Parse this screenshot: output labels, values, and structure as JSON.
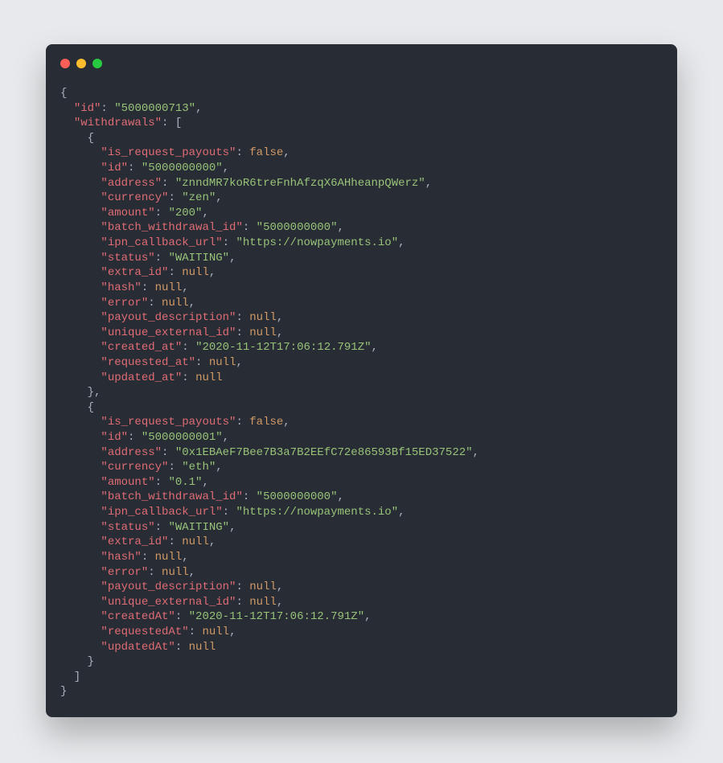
{
  "colors": {
    "bg_page": "#e7e9ec",
    "bg_window": "#282c34",
    "text_plain": "#abb2bf",
    "text_key": "#e06c75",
    "text_string": "#98c379",
    "text_keyword": "#d19a66",
    "tl_red": "#ff5f56",
    "tl_yellow": "#ffbd2e",
    "tl_green": "#27c93f"
  },
  "json_content": {
    "id": "5000000713",
    "withdrawals": [
      {
        "is_request_payouts": false,
        "id": "5000000000",
        "address": "znndMR7koR6treFnhAfzqX6AHheanpQWerz",
        "currency": "zen",
        "amount": "200",
        "batch_withdrawal_id": "5000000000",
        "ipn_callback_url": "https://nowpayments.io",
        "status": "WAITING",
        "extra_id": null,
        "hash": null,
        "error": null,
        "payout_description": null,
        "unique_external_id": null,
        "created_at": "2020-11-12T17:06:12.791Z",
        "requested_at": null,
        "updated_at": null
      },
      {
        "is_request_payouts": false,
        "id": "5000000001",
        "address": "0x1EBAeF7Bee7B3a7B2EEfC72e86593Bf15ED37522",
        "currency": "eth",
        "amount": "0.1",
        "batch_withdrawal_id": "5000000000",
        "ipn_callback_url": "https://nowpayments.io",
        "status": "WAITING",
        "extra_id": null,
        "hash": null,
        "error": null,
        "payout_description": null,
        "unique_external_id": null,
        "createdAt": "2020-11-12T17:06:12.791Z",
        "requestedAt": null,
        "updatedAt": null
      }
    ]
  },
  "key_tokens": {
    "id": "\"id\"",
    "withdrawals": "\"withdrawals\"",
    "is_request_payouts": "\"is_request_payouts\"",
    "address": "\"address\"",
    "currency": "\"currency\"",
    "amount": "\"amount\"",
    "batch_withdrawal_id": "\"batch_withdrawal_id\"",
    "ipn_callback_url": "\"ipn_callback_url\"",
    "status": "\"status\"",
    "extra_id": "\"extra_id\"",
    "hash": "\"hash\"",
    "error": "\"error\"",
    "payout_description": "\"payout_description\"",
    "unique_external_id": "\"unique_external_id\"",
    "created_at": "\"created_at\"",
    "requested_at": "\"requested_at\"",
    "updated_at": "\"updated_at\"",
    "createdAt": "\"createdAt\"",
    "requestedAt": "\"requestedAt\"",
    "updatedAt": "\"updatedAt\""
  },
  "val_tokens": {
    "root_id": "\"5000000713\"",
    "w0_id": "\"5000000000\"",
    "w0_address": "\"znndMR7koR6treFnhAfzqX6AHheanpQWerz\"",
    "w0_currency": "\"zen\"",
    "w0_amount": "\"200\"",
    "w0_batch": "\"5000000000\"",
    "w0_ipn": "\"https://nowpayments.io\"",
    "w0_status": "\"WAITING\"",
    "w0_created": "\"2020-11-12T17:06:12.791Z\"",
    "w1_id": "\"5000000001\"",
    "w1_address": "\"0x1EBAeF7Bee7B3a7B2EEfC72e86593Bf15ED37522\"",
    "w1_currency": "\"eth\"",
    "w1_amount": "\"0.1\"",
    "w1_batch": "\"5000000000\"",
    "w1_ipn": "\"https://nowpayments.io\"",
    "w1_status": "\"WAITING\"",
    "w1_created": "\"2020-11-12T17:06:12.791Z\"",
    "false": "false",
    "null": "null"
  }
}
